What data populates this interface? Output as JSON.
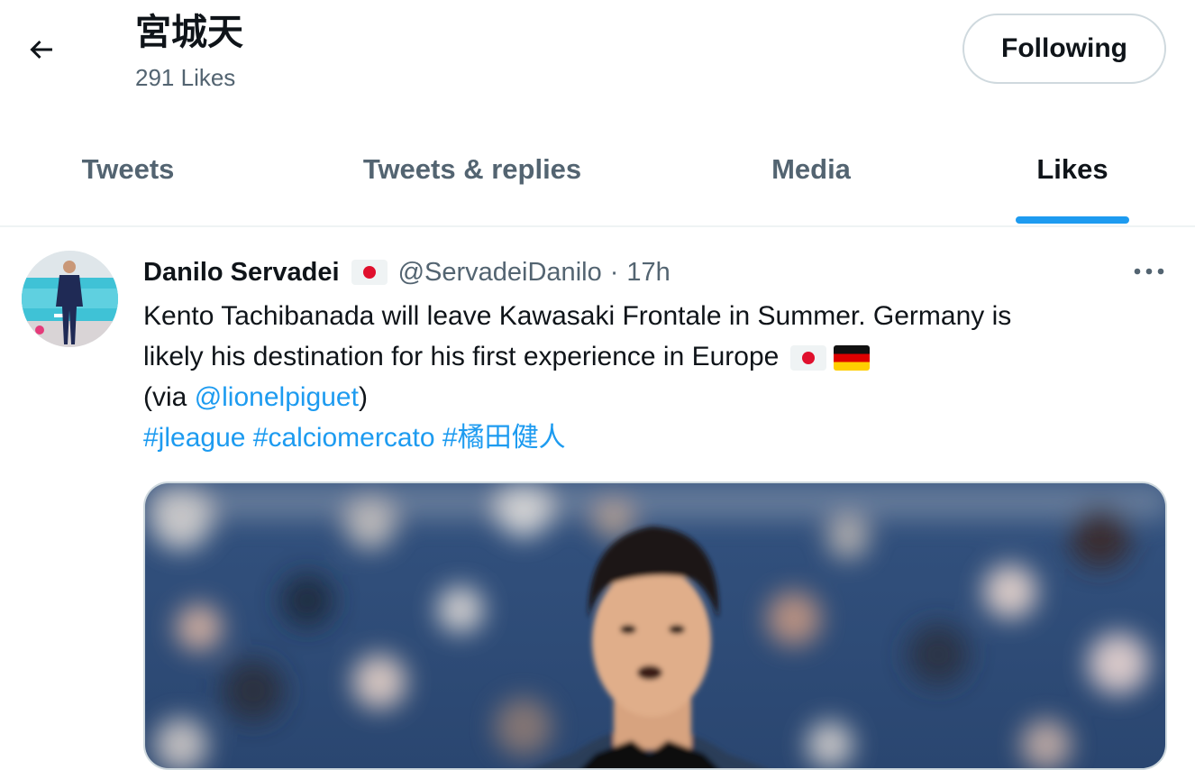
{
  "header": {
    "title": "宮城天",
    "subtitle": "291 Likes",
    "follow_label": "Following"
  },
  "tabs": [
    {
      "label": "Tweets"
    },
    {
      "label": "Tweets & replies"
    },
    {
      "label": "Media"
    },
    {
      "label": "Likes",
      "active": true
    }
  ],
  "tweet": {
    "author_name": "Danilo Servadei",
    "handle": "@ServadeiDanilo",
    "separator": "·",
    "time": "17h",
    "line1": "Kento Tachibanada will leave Kawasaki Frontale in Summer. Germany is",
    "line2": "likely his destination for his first experience in Europe",
    "via_prefix": "(via ",
    "via_mention": "@lionelpiguet",
    "via_suffix": ")",
    "hashtags": [
      "#jleague",
      "#calciomercato",
      "#橘田健人"
    ]
  },
  "colors": {
    "accent": "#1d9bf0",
    "text_primary": "#0f1419",
    "text_secondary": "#536471",
    "border": "#cfd9de"
  },
  "icons": {
    "back": "arrow-left-icon",
    "more": "more-horizontal-icon",
    "flag_japan": "japan-flag-icon",
    "flag_germany": "germany-flag-icon"
  }
}
